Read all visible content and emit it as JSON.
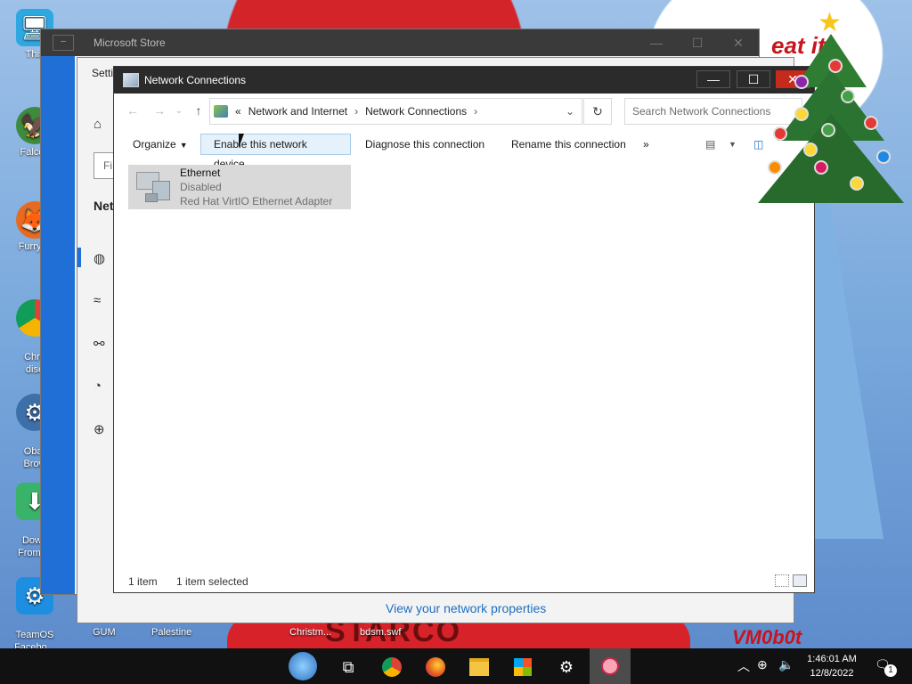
{
  "desktop": {
    "icons": [
      {
        "label": "This"
      },
      {
        "label": "Falcon"
      },
      {
        "label": "Furry C"
      },
      {
        "label": "Chro\ndise"
      },
      {
        "label": "Obar\nBrow"
      },
      {
        "label": "Down\nFrom te"
      },
      {
        "label": "TeamOS\nFacebo..."
      }
    ],
    "bottom_labels": [
      "GUM",
      "Palestine",
      "Christm...",
      "bdsm.swf"
    ],
    "wallpaper_texts": [
      "eat it",
      "STARCO",
      "VM0b0t"
    ]
  },
  "store_window": {
    "title": "Microsoft Store"
  },
  "settings_window": {
    "title": "Setti",
    "search_text": "Fi",
    "section": "Net",
    "link": "View your network properties"
  },
  "network_window": {
    "title": "Network Connections",
    "breadcrumb": {
      "overflow": "«",
      "items": [
        "Network and Internet",
        "Network Connections"
      ]
    },
    "search_placeholder": "Search Network Connections",
    "toolbar": {
      "organize": "Organize",
      "enable": "Enable this network device",
      "diagnose": "Diagnose this connection",
      "rename": "Rename this connection",
      "more": "»"
    },
    "connection": {
      "name": "Ethernet",
      "status": "Disabled",
      "device": "Red Hat VirtIO Ethernet Adapter"
    },
    "statusbar": {
      "count": "1 item",
      "selected": "1 item selected"
    }
  },
  "taskbar": {
    "time": "1:46:01 AM",
    "date": "12/8/2022",
    "notification_count": "1"
  },
  "colors": {
    "accent": "#1f6fd6",
    "title_bar": "#2b2b2b",
    "hover_bg": "#e5f1fb",
    "selected_item": "#d9d9d9",
    "link": "#1d6fc1"
  }
}
